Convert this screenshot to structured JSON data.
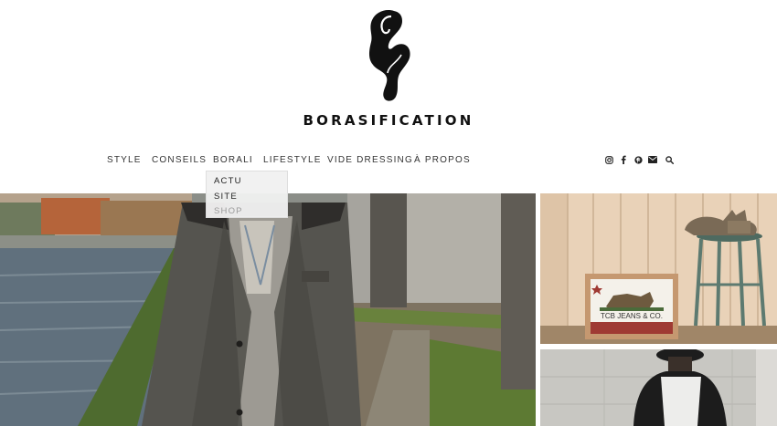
{
  "site": {
    "name": "BORASIFICATION"
  },
  "nav": {
    "items": [
      {
        "label": "STYLE"
      },
      {
        "label": "CONSEILS"
      },
      {
        "label": "BORALI"
      },
      {
        "label": "LIFESTYLE"
      },
      {
        "label": "VIDE DRESSING"
      },
      {
        "label": "À PROPOS"
      }
    ]
  },
  "dropdown": {
    "parent": "BORALI",
    "items": [
      {
        "label": "ACTU"
      },
      {
        "label": "SITE"
      },
      {
        "label": "SHOP"
      }
    ]
  },
  "social": [
    "instagram-icon",
    "facebook-icon",
    "pinterest-icon",
    "email-icon",
    "search-icon"
  ],
  "thumb1": {
    "frame_text": "TCB JEANS & CO."
  }
}
